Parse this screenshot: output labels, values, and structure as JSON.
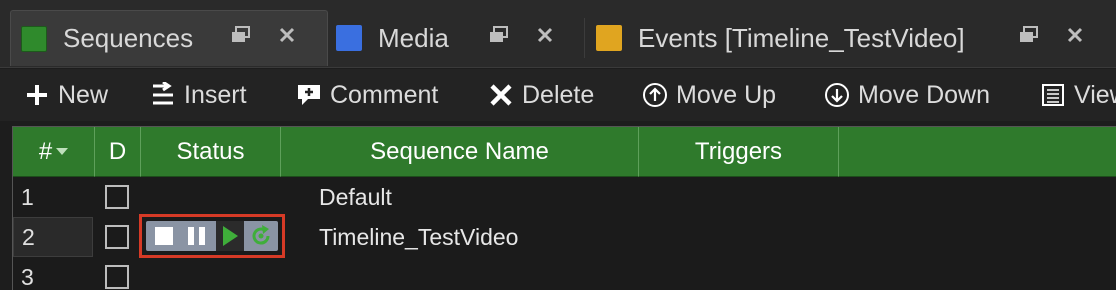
{
  "tabs": [
    {
      "label": "Sequences",
      "swatch": "#2f8a2c",
      "active": true
    },
    {
      "label": "Media",
      "swatch": "#3a6fe0",
      "active": false
    },
    {
      "label": "Events [Timeline_TestVideo]",
      "swatch": "#e0a520",
      "active": false
    }
  ],
  "toolbar": {
    "new_label": "New",
    "insert_label": "Insert",
    "comment_label": "Comment",
    "delete_label": "Delete",
    "move_up_label": "Move Up",
    "move_down_label": "Move Down",
    "view_label": "View"
  },
  "grid": {
    "columns": [
      "#",
      "D",
      "Status",
      "Sequence Name",
      "Triggers",
      ""
    ],
    "header_color": "#2f7a2c",
    "rows": [
      {
        "num": "1",
        "d_checked": false,
        "name": "Default",
        "has_status": false
      },
      {
        "num": "2",
        "d_checked": false,
        "name": "Timeline_TestVideo",
        "has_status": true
      },
      {
        "num": "3",
        "d_checked": false,
        "name": "",
        "has_status": false
      }
    ]
  },
  "status_controls": [
    "stop-icon",
    "pause-icon",
    "play-icon",
    "loop-icon"
  ],
  "highlight_color": "#d63a26"
}
